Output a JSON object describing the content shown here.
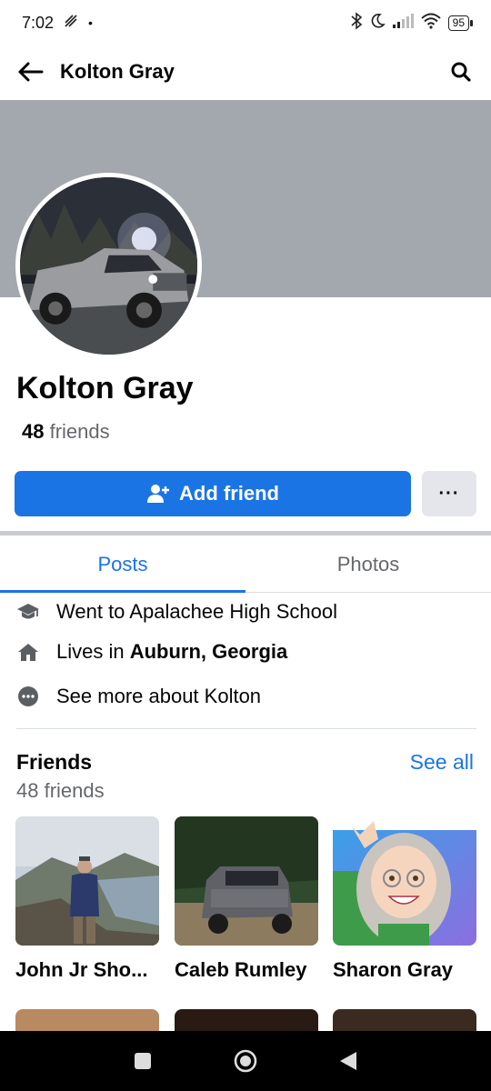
{
  "status": {
    "time": "7:02",
    "battery": "95"
  },
  "header": {
    "title": "Kolton Gray",
    "back_icon": "arrow-left-icon",
    "search_icon": "search-icon"
  },
  "profile": {
    "name": "Kolton Gray",
    "friends_count": "48",
    "friends_label": "friends",
    "add_friend_label": "Add friend",
    "more_label": "···"
  },
  "tabs": [
    {
      "label": "Posts",
      "active": true
    },
    {
      "label": "Photos",
      "active": false
    }
  ],
  "intro": {
    "education": "Went to Apalachee High School",
    "lives_prefix": "Lives in ",
    "lives_place": "Auburn, Georgia",
    "see_more": "See more about Kolton"
  },
  "friends": {
    "title": "Friends",
    "see_all": "See all",
    "subtitle": "48 friends",
    "cards": [
      {
        "name": "John Jr Sho..."
      },
      {
        "name": "Caleb Rumley"
      },
      {
        "name": "Sharon Gray"
      }
    ]
  },
  "colors": {
    "accent": "#1b74e4",
    "cover": "#a3a8ae",
    "secondary_text": "#65676b"
  }
}
